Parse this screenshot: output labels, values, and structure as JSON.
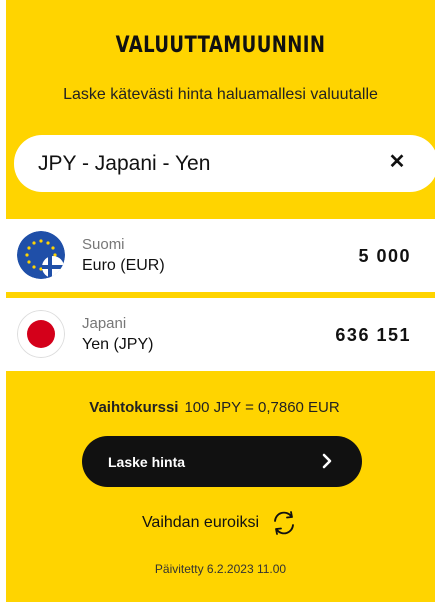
{
  "header": {
    "title": "VALUUTTAMUUNNIN",
    "subtitle": "Laske kätevästi hinta haluamallesi valuutalle"
  },
  "search": {
    "value": "JPY - Japani - Yen",
    "clear_icon": "close-icon"
  },
  "rows": [
    {
      "country": "Suomi",
      "currency": "Euro (EUR)",
      "amount": "5 000",
      "flag_icon": "eu-finland-flag-icon"
    },
    {
      "country": "Japani",
      "currency": "Yen (JPY)",
      "amount": "636 151",
      "flag_icon": "japan-flag-icon"
    }
  ],
  "rate": {
    "label": "Vaihtokurssi",
    "value": "100 JPY = 0,7860 EUR"
  },
  "calculate_button": {
    "label": "Laske hinta",
    "icon": "chevron-right-icon"
  },
  "swap": {
    "label": "Vaihdan euroiksi",
    "icon": "swap-arrows-icon"
  },
  "footer": {
    "updated": "Päivitetty 6.2.2023 11.00"
  },
  "colors": {
    "accent": "#ffd400",
    "button": "#111111",
    "eu_blue": "#1f4fa8",
    "japan_red": "#d4001a"
  }
}
